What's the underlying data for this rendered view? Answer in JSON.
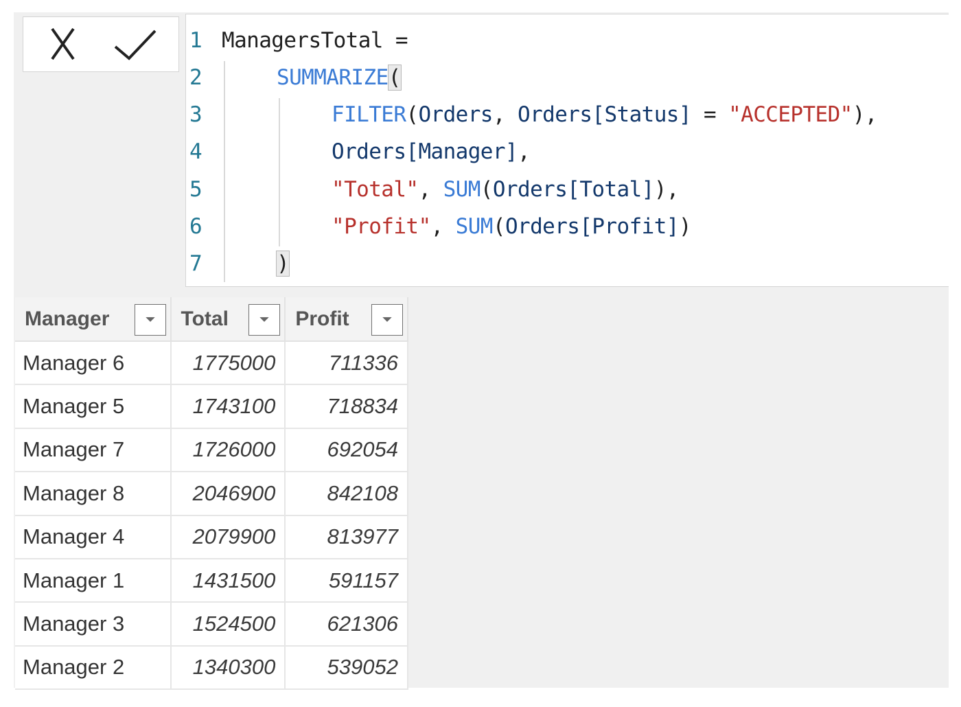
{
  "toolbar": {
    "cancel_icon": "close-icon",
    "commit_icon": "checkmark-icon"
  },
  "editor": {
    "lines": [
      {
        "number": "1",
        "tokens": [
          {
            "text": "ManagersTotal =",
            "kind": "plain"
          }
        ]
      },
      {
        "number": "2",
        "tokens": [
          {
            "text": "SUMMARIZE",
            "kind": "fn"
          },
          {
            "text": "(",
            "kind": "bracket"
          }
        ]
      },
      {
        "number": "3",
        "tokens": [
          {
            "text": "FILTER",
            "kind": "fn"
          },
          {
            "text": "(",
            "kind": "punct"
          },
          {
            "text": "Orders",
            "kind": "ident"
          },
          {
            "text": ", ",
            "kind": "punct"
          },
          {
            "text": "Orders[Status]",
            "kind": "ident"
          },
          {
            "text": " = ",
            "kind": "punct"
          },
          {
            "text": "\"ACCEPTED\"",
            "kind": "str"
          },
          {
            "text": "),",
            "kind": "punct"
          }
        ]
      },
      {
        "number": "4",
        "tokens": [
          {
            "text": "Orders[Manager]",
            "kind": "ident"
          },
          {
            "text": ",",
            "kind": "punct"
          }
        ]
      },
      {
        "number": "5",
        "tokens": [
          {
            "text": "\"Total\"",
            "kind": "str"
          },
          {
            "text": ", ",
            "kind": "punct"
          },
          {
            "text": "SUM",
            "kind": "fn"
          },
          {
            "text": "(",
            "kind": "punct"
          },
          {
            "text": "Orders[Total]",
            "kind": "ident"
          },
          {
            "text": "),",
            "kind": "punct"
          }
        ]
      },
      {
        "number": "6",
        "tokens": [
          {
            "text": "\"Profit\"",
            "kind": "str"
          },
          {
            "text": ", ",
            "kind": "punct"
          },
          {
            "text": "SUM",
            "kind": "fn"
          },
          {
            "text": "(",
            "kind": "punct"
          },
          {
            "text": "Orders[Profit]",
            "kind": "ident"
          },
          {
            "text": ")",
            "kind": "punct"
          }
        ]
      },
      {
        "number": "7",
        "tokens": [
          {
            "text": ")",
            "kind": "bracket"
          }
        ]
      }
    ]
  },
  "table": {
    "columns": [
      "Manager",
      "Total",
      "Profit"
    ],
    "filter_icon": "dropdown-arrow-icon",
    "rows": [
      {
        "manager": "Manager 6",
        "total": "1775000",
        "profit": "711336"
      },
      {
        "manager": "Manager 5",
        "total": "1743100",
        "profit": "718834"
      },
      {
        "manager": "Manager 7",
        "total": "1726000",
        "profit": "692054"
      },
      {
        "manager": "Manager 8",
        "total": "2046900",
        "profit": "842108"
      },
      {
        "manager": "Manager 4",
        "total": "2079900",
        "profit": "813977"
      },
      {
        "manager": "Manager 1",
        "total": "1431500",
        "profit": "591157"
      },
      {
        "manager": "Manager 3",
        "total": "1524500",
        "profit": "621306"
      },
      {
        "manager": "Manager 2",
        "total": "1340300",
        "profit": "539052"
      }
    ]
  },
  "colors": {
    "line_number": "#237893",
    "function": "#3a7bd5",
    "identifier": "#13386b",
    "string": "#b7312c"
  }
}
